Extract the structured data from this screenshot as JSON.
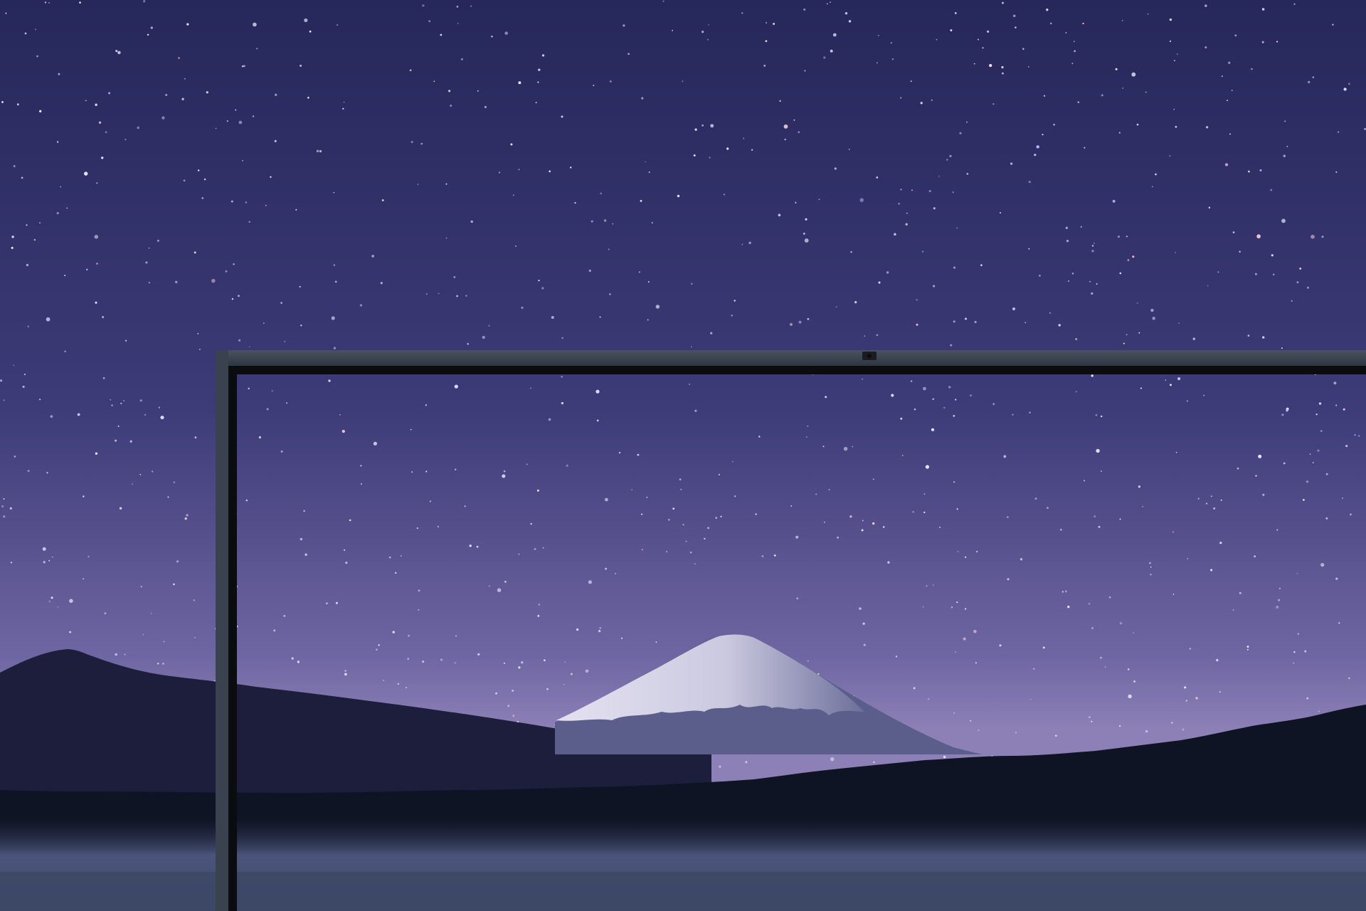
{
  "scene": {
    "description_visible_text": "",
    "colors": {
      "sky_top": "#27285a",
      "sky_mid": "#4a4584",
      "sky_horizon": "#8a7fb4",
      "mountain_far": "#1e1f3c",
      "mountain_snow": "#d9d8ea",
      "mountain_shadow": "#5c5f8a",
      "forest": "#101626",
      "mist": "#5f6a8e",
      "water": "#3f4a6b",
      "bezel": "#39414f",
      "bezel_inner": "#0b0c10",
      "webcam": "#1a1c22"
    },
    "icons": {
      "webcam": "webcam-icon"
    }
  }
}
